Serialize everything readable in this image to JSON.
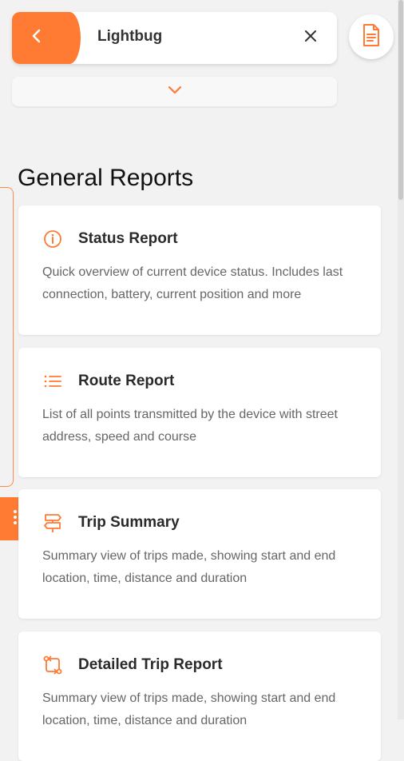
{
  "header": {
    "title": "Lightbug"
  },
  "colors": {
    "accent": "#ff7a33",
    "background": "#f2f2f2",
    "card": "#ffffff"
  },
  "icons": {
    "back": "chevron-left-icon",
    "close": "close-icon",
    "document": "document-icon",
    "expand": "chevron-down-icon",
    "more": "more-vertical-icon"
  },
  "section": {
    "title": "General Reports"
  },
  "reports": [
    {
      "title": "Status Report",
      "icon": "info-icon",
      "description": "Quick overview of current device status. Includes last connection, battery, current position and more"
    },
    {
      "title": "Route Report",
      "icon": "list-icon",
      "description": "List of all points transmitted by the device with street address, speed and course"
    },
    {
      "title": "Trip Summary",
      "icon": "signpost-icon",
      "description": "Summary view of trips made, showing start and end location, time, distance and duration"
    },
    {
      "title": "Detailed Trip Report",
      "icon": "route-icon",
      "description": "Summary view of trips made, showing start and end location, time, distance and duration"
    }
  ]
}
